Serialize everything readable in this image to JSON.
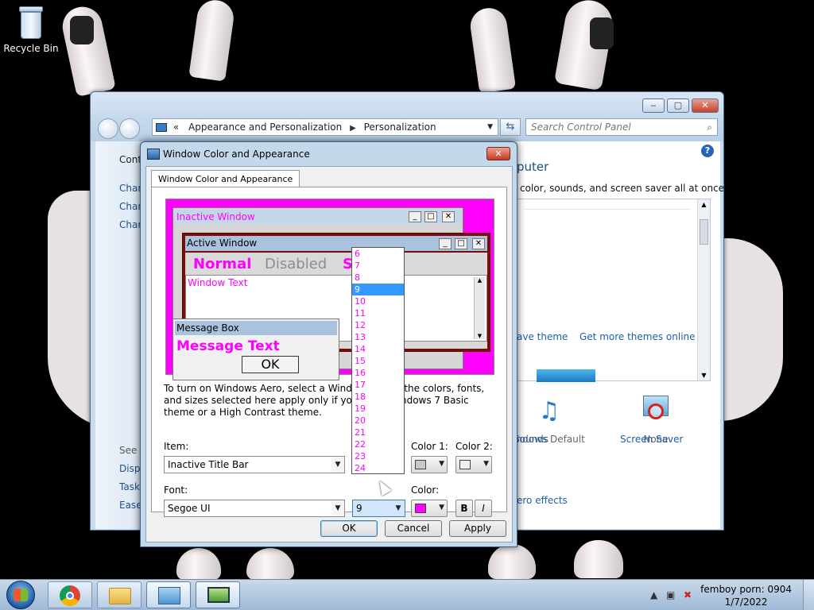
{
  "desktop": {
    "recycle_bin_label": "Recycle Bin"
  },
  "control_panel": {
    "address_prefix": "«",
    "breadcrumb": [
      "Appearance and Personalization",
      "Personalization"
    ],
    "search_placeholder": "Search Control Panel",
    "left_items": [
      "Cont",
      "Chan",
      "Chan",
      "Chan",
      "See a",
      "Displ",
      "Taskb",
      "Ease"
    ],
    "heading_partial": "puter",
    "description_partial": "color, sounds, and screen saver all at once.",
    "theme_links": [
      "ave theme",
      "Get more themes online"
    ],
    "sounds_label": "Sounds",
    "sounds_sub": "indows Default",
    "screensaver_label": "Screen Saver",
    "screensaver_sub": "None",
    "aero_link_partial": "ero effects"
  },
  "dialog": {
    "title": "Window Color and Appearance",
    "tab_label": "Window Color and Appearance",
    "preview": {
      "inactive_title": "Inactive Window",
      "active_title": "Active Window",
      "menu_normal": "Normal",
      "menu_disabled": "Disabled",
      "menu_selected": "S",
      "window_text": "Window Text",
      "message_box_title": "Message Box",
      "message_text": "Message Text",
      "ok_label": "OK"
    },
    "info_text": "To turn on Windows Aero, select a Windows                          me of the colors, fonts, and sizes selected here apply only if yo                          ed the Windows 7 Basic theme or a High Contrast theme.",
    "item_label": "Item:",
    "item_value": "Inactive Title Bar",
    "color1_label": "Color 1:",
    "color2_label": "Color 2:",
    "font_label": "Font:",
    "font_value": "Segoe UI",
    "size_value": "9",
    "color_label": "Color:",
    "bold_label": "B",
    "italic_label": "I",
    "ok_button": "OK",
    "cancel_button": "Cancel",
    "apply_button": "Apply",
    "colors": {
      "font_color": "#ff00ff",
      "color1": "#c8c8c8",
      "color2": "#f0f0f0"
    }
  },
  "size_dropdown": {
    "options": [
      "6",
      "7",
      "8",
      "9",
      "10",
      "11",
      "12",
      "13",
      "14",
      "15",
      "16",
      "17",
      "18",
      "19",
      "20",
      "21",
      "22",
      "23",
      "24"
    ],
    "selected": "9"
  },
  "taskbar": {
    "pinned": [
      "start-button",
      "chrome",
      "explorer",
      "control-panel",
      "display-settings"
    ],
    "clock_line1": "femboy porn: 0904",
    "clock_line2": "1/7/2022"
  }
}
